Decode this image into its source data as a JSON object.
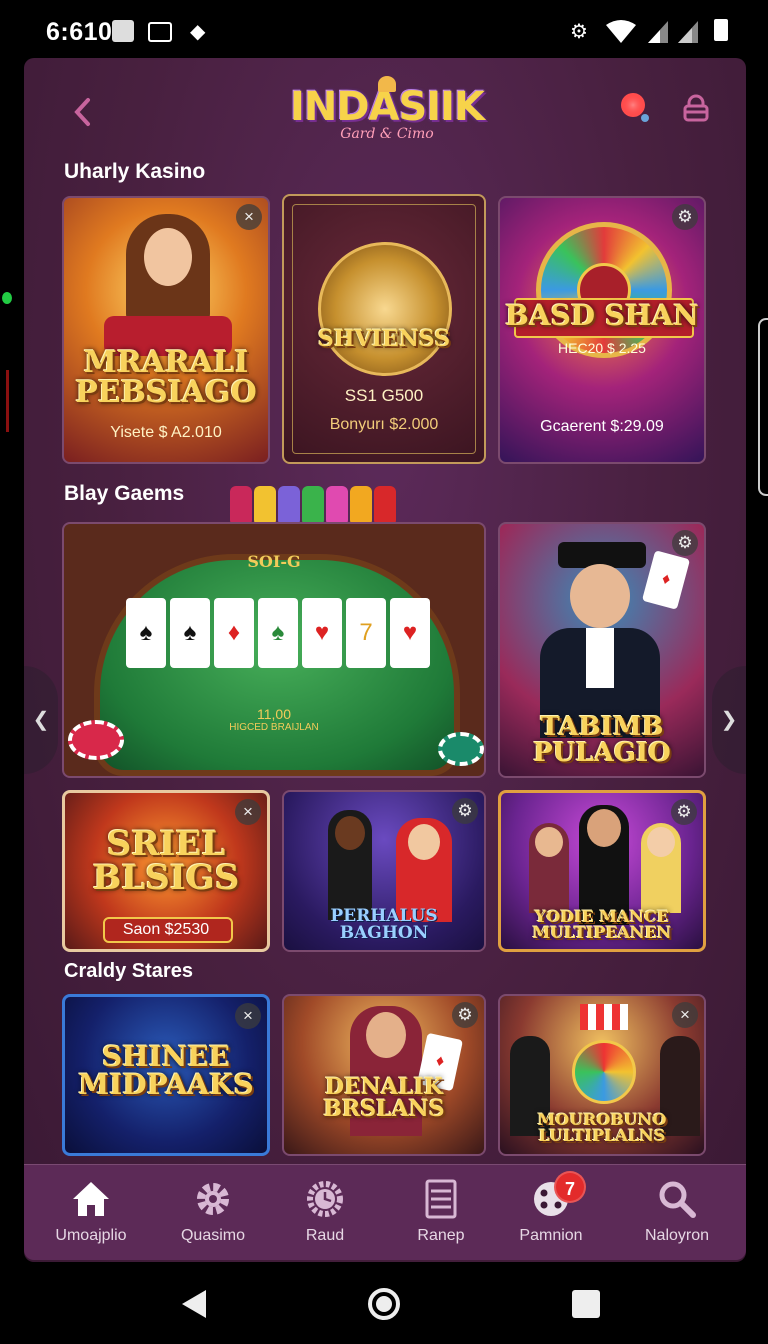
{
  "status_bar": {
    "time": "6:610"
  },
  "header": {
    "brand": "INDASIIK",
    "tagline": "Gard & Cimo"
  },
  "sections": [
    {
      "title": "Uharly Kasino"
    },
    {
      "title": "Blay Gaems"
    },
    {
      "title": "Craldy Stares"
    }
  ],
  "cards": {
    "c1": {
      "title": "MRARALI PEBSIAGO",
      "sub": "Yisete $ A2.010"
    },
    "c2": {
      "title": "SHVIENSS",
      "line1": "SS1 G500",
      "sub": "Bonyurı $2.000"
    },
    "c3": {
      "title": "BASD SHAN",
      "line1": "HEC20 $ 2.25",
      "sub": "Gcaerent $:29.09"
    },
    "c4": {
      "felt": "SOI-G",
      "line1": "11,00",
      "line2": "HIGCED BRAIJLAN"
    },
    "c5": {
      "title": "TABIMB PULAGIO"
    },
    "c6": {
      "title": "SRIEL BLSIGS",
      "sub": "Saon $2530"
    },
    "c7": {
      "title": "PERHALUS BAGHON"
    },
    "c8": {
      "title": "YODIE MANCE MULTIPEANEN"
    },
    "c9": {
      "title": "SHINEE MIDPAAKS"
    },
    "c10": {
      "title": "DENALIK BRSLANS"
    },
    "c11": {
      "title": "MOUROBUNO LULTIPLALNS"
    }
  },
  "bottom_nav": [
    {
      "label": "Umoajplio",
      "icon": "home-icon"
    },
    {
      "label": "Quasimo",
      "icon": "gear-icon"
    },
    {
      "label": "Raud",
      "icon": "clock-gear-icon"
    },
    {
      "label": "Ranep",
      "icon": "list-icon"
    },
    {
      "label": "Pamnion",
      "icon": "dice-icon",
      "badge": "7"
    },
    {
      "label": "Naloyron",
      "icon": "search-icon"
    }
  ],
  "colors": {
    "background": "#48203f",
    "accent_gold": "#f8d25c",
    "badge_red": "#e32b2b"
  }
}
